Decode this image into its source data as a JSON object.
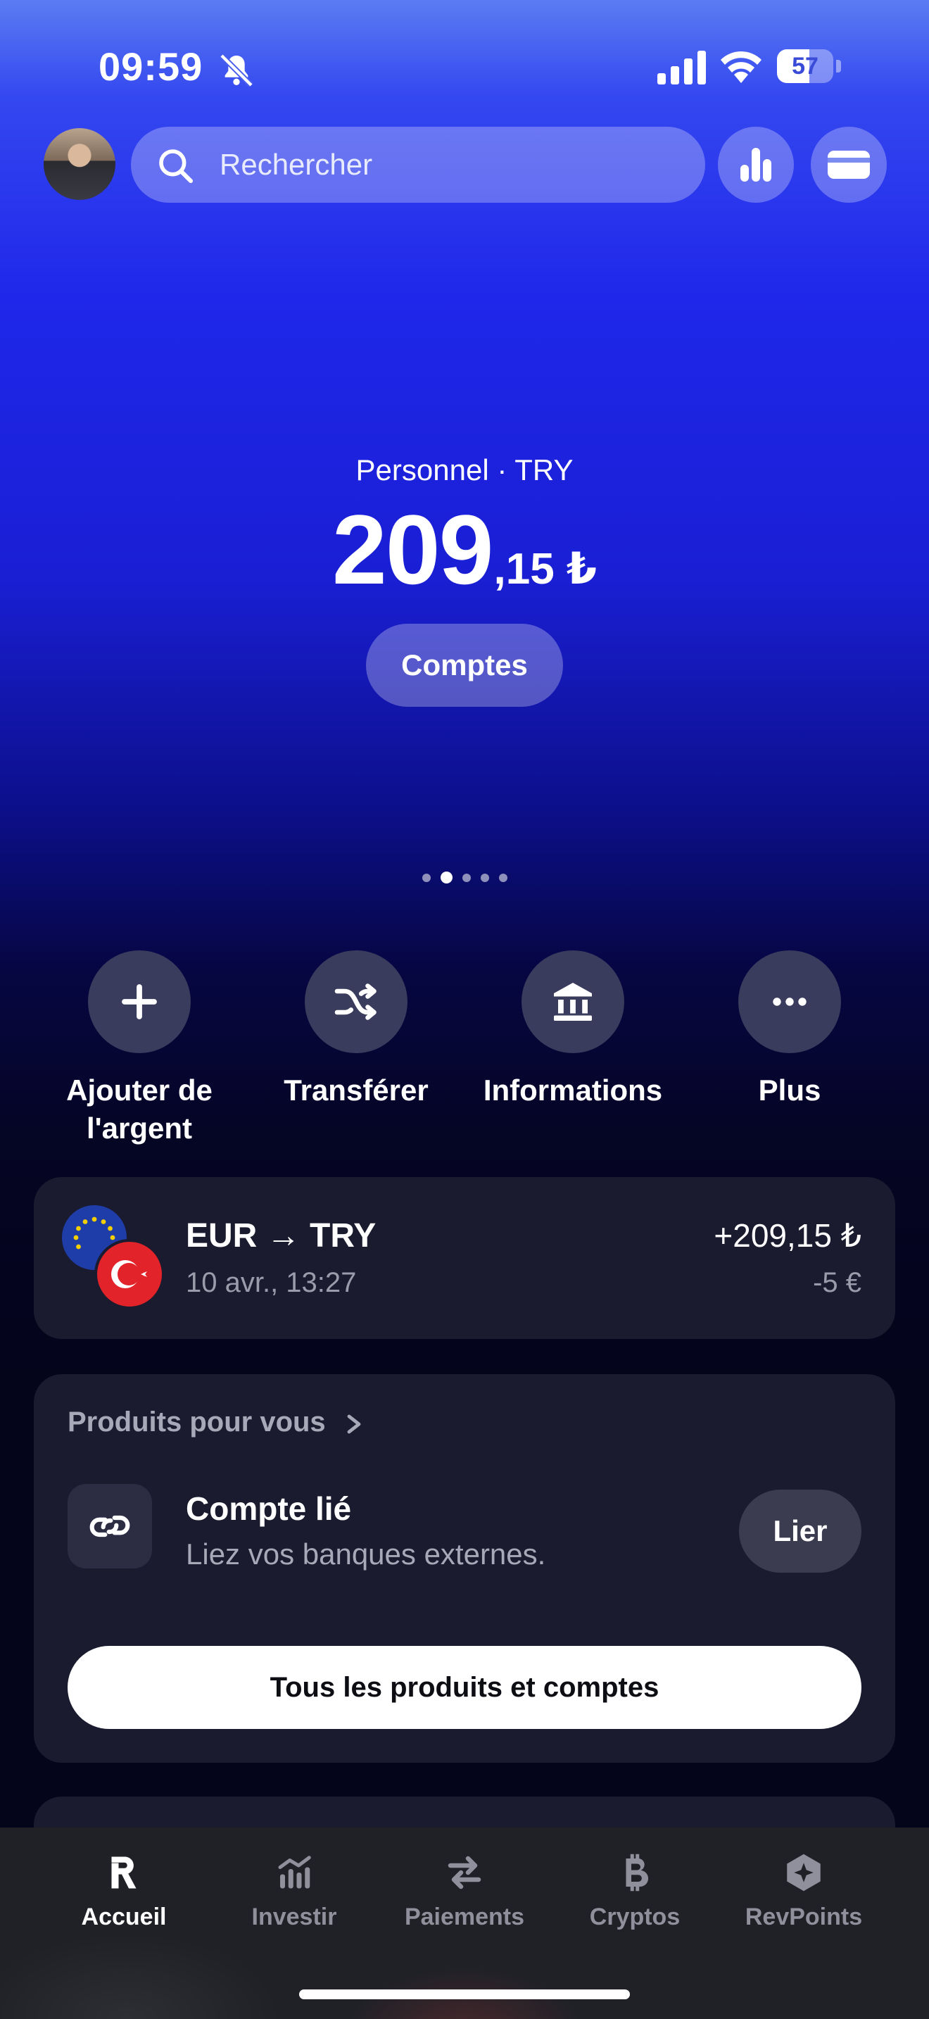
{
  "status_bar": {
    "time": "09:59",
    "battery": "57",
    "battery_level": 0.57
  },
  "search": {
    "placeholder": "Rechercher"
  },
  "balance": {
    "account_label": "Personnel · TRY",
    "amount_int": "209",
    "amount_dec": ",15 ₺",
    "accounts_button": "Comptes"
  },
  "pager": {
    "count": 5,
    "active_index": 1
  },
  "quick_actions": [
    {
      "label": "Ajouter de l'argent",
      "icon": "plus-icon"
    },
    {
      "label": "Transférer",
      "icon": "shuffle-icon"
    },
    {
      "label": "Informations",
      "icon": "bank-icon"
    },
    {
      "label": "Plus",
      "icon": "more-icon"
    }
  ],
  "transaction": {
    "title": "EUR → TRY",
    "date": "10 avr., 13:27",
    "amount": "+209,15 ₺",
    "sub_amount": "-5 €"
  },
  "products": {
    "title": "Produits pour vous",
    "linked_title": "Compte lié",
    "linked_desc": "Liez vos banques externes.",
    "link_button": "Lier",
    "all_button": "Tous les produits et comptes"
  },
  "tabs": [
    {
      "label": "Accueil",
      "icon": "revolut-r-icon",
      "active": true
    },
    {
      "label": "Investir",
      "icon": "invest-icon",
      "active": false
    },
    {
      "label": "Paiements",
      "icon": "payments-icon",
      "active": false
    },
    {
      "label": "Cryptos",
      "icon": "bitcoin-icon",
      "active": false
    },
    {
      "label": "RevPoints",
      "icon": "revpoints-icon",
      "active": false
    }
  ],
  "colors": {
    "accent_blue": "#1f27ea",
    "card_bg": "#1a1b2e",
    "tabbar_bg": "#202127"
  }
}
